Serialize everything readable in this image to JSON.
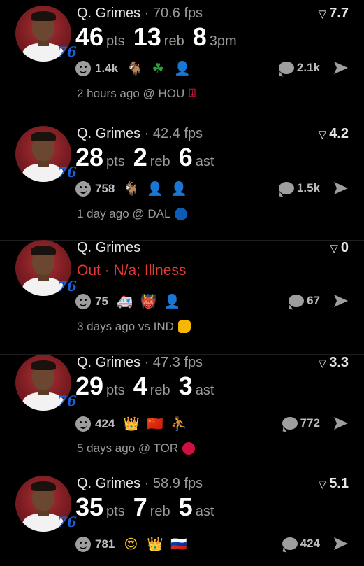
{
  "feed": {
    "cards": [
      {
        "player": "Q. Grimes",
        "fps": " · 70.6 fps",
        "rating": "7.7",
        "team_logo": "76",
        "stats": [
          {
            "value": "46",
            "label": "pts"
          },
          {
            "value": "13",
            "label": "reb"
          },
          {
            "value": "8",
            "label": "3pm"
          }
        ],
        "reactions": "1.4k",
        "emojis": [
          "🐐",
          "☘",
          "👤"
        ],
        "comments": "2.1k",
        "meta": "2 hours ago @ HOU",
        "opponent_logo": "rockets-logo"
      },
      {
        "player": "Q. Grimes",
        "fps": " · 42.4 fps",
        "rating": "4.2",
        "team_logo": "76",
        "stats": [
          {
            "value": "28",
            "label": "pts"
          },
          {
            "value": "2",
            "label": "reb"
          },
          {
            "value": "6",
            "label": "ast"
          }
        ],
        "reactions": "758",
        "emojis": [
          "🐐",
          "👤",
          "👤"
        ],
        "comments": "1.5k",
        "meta": "1 day ago @ DAL",
        "opponent_logo": "mavericks-logo"
      },
      {
        "player": "Q. Grimes",
        "fps": "",
        "rating": "0",
        "team_logo": "76",
        "status": "Out · N/a; Illness",
        "reactions": "75",
        "emojis": [
          "🚑",
          "👹",
          "👤"
        ],
        "comments": "67",
        "meta": "3 days ago vs IND",
        "opponent_logo": "pacers-logo"
      },
      {
        "player": "Q. Grimes",
        "fps": " · 47.3 fps",
        "rating": "3.3",
        "team_logo": "76",
        "stats": [
          {
            "value": "29",
            "label": "pts"
          },
          {
            "value": "4",
            "label": "reb"
          },
          {
            "value": "3",
            "label": "ast"
          }
        ],
        "reactions": "424",
        "emojis": [
          "👑",
          "🇨🇳",
          "⛹"
        ],
        "comments": "772",
        "meta": "5 days ago @ TOR",
        "opponent_logo": "raptors-logo"
      },
      {
        "player": "Q. Grimes",
        "fps": " · 58.9 fps",
        "rating": "5.1",
        "team_logo": "76",
        "stats": [
          {
            "value": "35",
            "label": "pts"
          },
          {
            "value": "7",
            "label": "reb"
          },
          {
            "value": "5",
            "label": "ast"
          }
        ],
        "reactions": "781",
        "emojis": [
          "😍",
          "👑",
          "🇷🇺"
        ],
        "comments": "424"
      }
    ]
  },
  "colors": {
    "background": "#000000",
    "status_out": "#e53935",
    "muted_text": "#9a9a9a",
    "sixers_blue": "#1d5fd6"
  }
}
